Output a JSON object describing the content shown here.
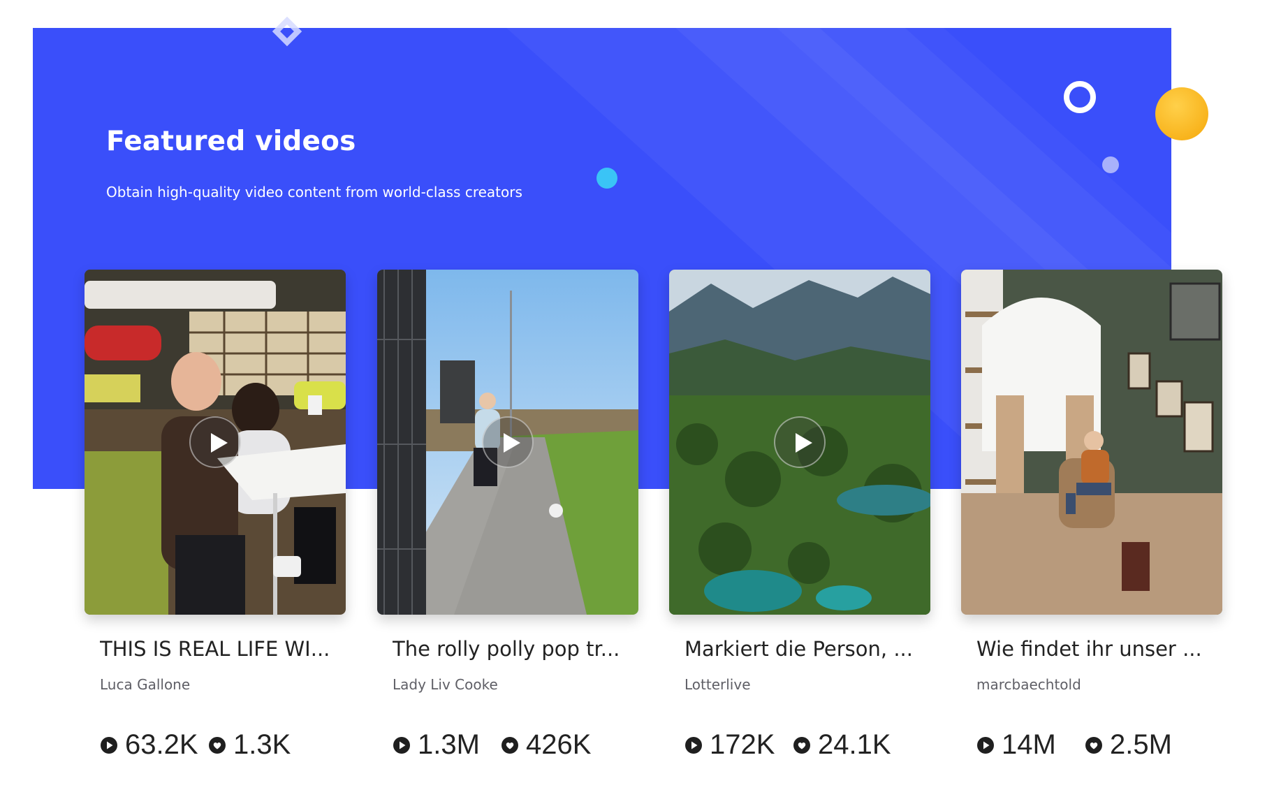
{
  "banner": {
    "title": "Featured videos",
    "subtitle": "Obtain high-quality video content from world-class creators",
    "background_color": "#3a4ffa"
  },
  "videos": [
    {
      "title": "THIS IS REAL LIFE WI...",
      "author": "Luca Gallone",
      "views": "63.2K",
      "likes": "1.3K",
      "thumbnail": "two-men-at-cafe-table"
    },
    {
      "title": "The rolly polly pop tr...",
      "author": "Lady Liv Cooke",
      "views": "1.3M",
      "likes": "426K",
      "thumbnail": "girl-kicking-football-on-path"
    },
    {
      "title": "Markiert die Person, ...",
      "author": "Lotterlive",
      "views": "172K",
      "likes": "24.1K",
      "thumbnail": "forest-valley-and-mountains"
    },
    {
      "title": "Wie findet ihr unser ...",
      "author": "marcbaechtold",
      "views": "14M",
      "likes": "2.5M",
      "thumbnail": "woman-in-armchair-in-library"
    }
  ],
  "icons": {
    "views": "play-circle-icon",
    "likes": "heart-circle-icon"
  }
}
